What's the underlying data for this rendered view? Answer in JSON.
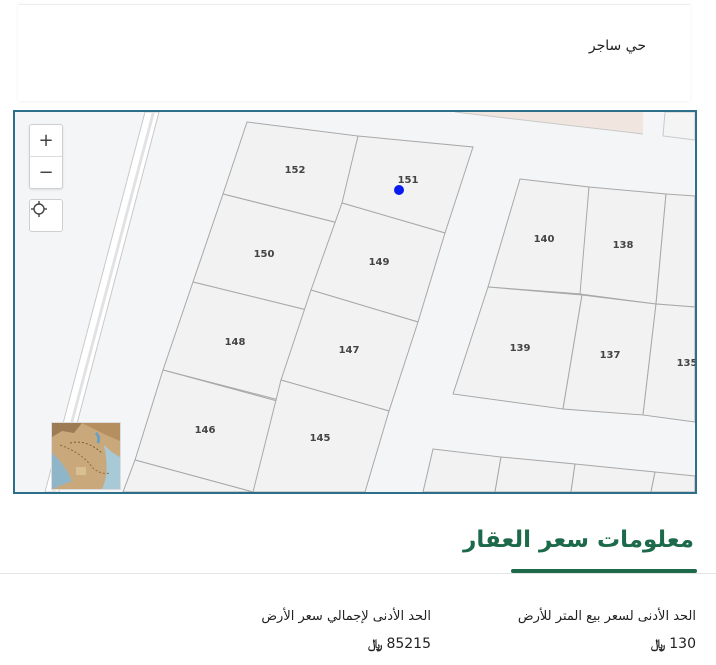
{
  "district": "حي ساجر",
  "map": {
    "zoom_in": "+",
    "zoom_out": "−",
    "parcels": [
      {
        "id": "152",
        "label": "152"
      },
      {
        "id": "151",
        "label": "151"
      },
      {
        "id": "150",
        "label": "150"
      },
      {
        "id": "149",
        "label": "149"
      },
      {
        "id": "148",
        "label": "148"
      },
      {
        "id": "147",
        "label": "147"
      },
      {
        "id": "146",
        "label": "146"
      },
      {
        "id": "145",
        "label": "145"
      },
      {
        "id": "140",
        "label": "140"
      },
      {
        "id": "138",
        "label": "138"
      },
      {
        "id": "139",
        "label": "139"
      },
      {
        "id": "137",
        "label": "137"
      },
      {
        "id": "135",
        "label": "135"
      }
    ]
  },
  "price_info": {
    "title": "معلومات سعر العقار",
    "min_price_per_meter_label": "الحد الأدنى لسعر بيع المتر للأرض",
    "min_price_per_meter_value": "130",
    "min_total_label": "الحد الأدنى لإجمالي سعر الأرض",
    "min_total_value": "85215",
    "currency_symbol": "﷼"
  }
}
